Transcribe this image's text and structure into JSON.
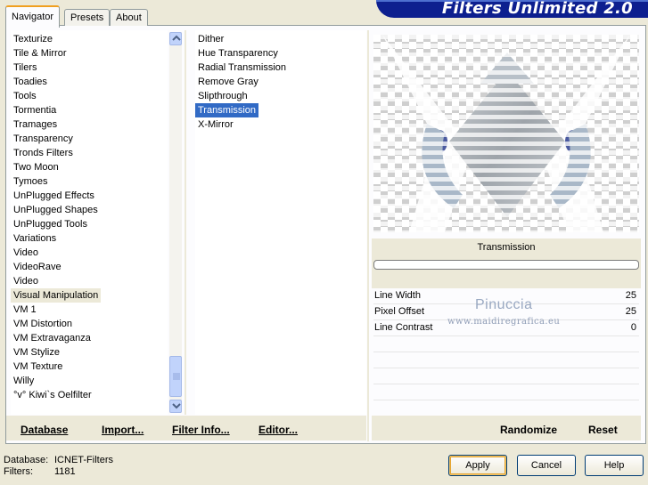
{
  "tabs": [
    "Navigator",
    "Presets",
    "About"
  ],
  "banner_title": "Filters Unlimited 2.0",
  "categories": [
    "Texturize",
    "Tile & Mirror",
    "Tilers",
    "Toadies",
    "Tools",
    "Tormentia",
    "Tramages",
    "Transparency",
    "Tronds Filters",
    "Two Moon",
    "Tymoes",
    "UnPlugged Effects",
    "UnPlugged Shapes",
    "UnPlugged Tools",
    "Variations",
    "Video",
    "VideoRave",
    "Video",
    "Visual Manipulation",
    "VM 1",
    "VM Distortion",
    "VM Extravaganza",
    "VM Stylize",
    "VM Texture",
    "Willy",
    "°v° Kiwi`s Oelfilter"
  ],
  "selected_category_index": 18,
  "filters": [
    "Dither",
    "Hue Transparency",
    "Radial Transmission",
    "Remove Gray",
    "Slipthrough",
    "Transmission",
    "X-Mirror"
  ],
  "selected_filter_index": 5,
  "filter_title": "Transmission",
  "params": [
    {
      "name": "Line Width",
      "value": "25"
    },
    {
      "name": "Pixel Offset",
      "value": "25"
    },
    {
      "name": "Line Contrast",
      "value": "0"
    }
  ],
  "watermark": {
    "name": "Pinuccia",
    "site": "www.maidiregrafica.eu"
  },
  "toolbar": {
    "database": "Database",
    "import": "Import...",
    "filter_info": "Filter Info...",
    "editor": "Editor...",
    "randomize": "Randomize",
    "reset": "Reset"
  },
  "footer": {
    "database_label": "Database:",
    "database_value": "ICNET-Filters",
    "filters_label": "Filters:",
    "filters_value": "1181"
  },
  "buttons": {
    "apply": "Apply",
    "cancel": "Cancel",
    "help": "Help"
  },
  "colors": {
    "selection": "#316ac5",
    "banner": "#0d1f8f",
    "dialog_bg": "#ece9d8"
  }
}
